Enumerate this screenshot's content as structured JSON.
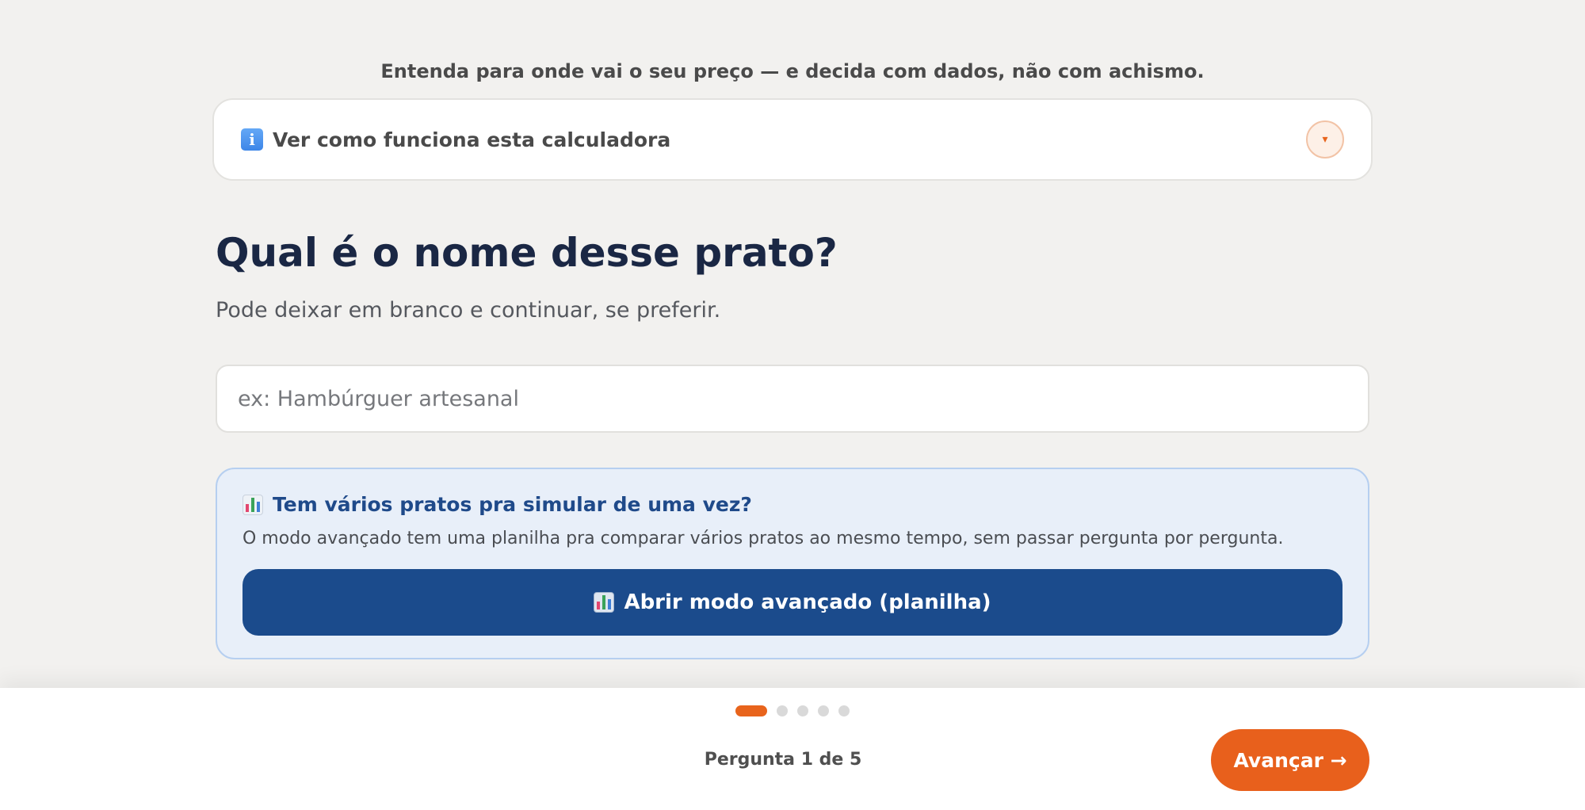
{
  "header": {
    "subtitle": "Entenda para onde vai o seu preço — e decida com dados, não com achismo."
  },
  "info": {
    "icon": "info-icon",
    "icon_glyph": "i",
    "label": "Ver como funciona esta calculadora",
    "toggle_glyph": "▾"
  },
  "question": {
    "title": "Qual é o nome desse prato?",
    "hint": "Pode deixar em branco e continuar, se preferir.",
    "input_value": "",
    "input_placeholder": "ex: Hambúrguer artesanal"
  },
  "advanced": {
    "icon": "bar-chart-icon",
    "title": "Tem vários pratos pra simular de uma vez?",
    "description": "O modo avançado tem uma planilha pra comparar vários pratos ao mesmo tempo, sem passar pergunta por pergunta.",
    "button_label": "Abrir modo avançado (planilha)"
  },
  "footer": {
    "current_step": 1,
    "total_steps": 5,
    "progress_label": "Pergunta 1 de 5",
    "next_label": "Avançar →"
  },
  "colors": {
    "accent": "#e8601c",
    "primary": "#1b4b8c",
    "heading": "#1a2744",
    "background": "#f2f1ef"
  }
}
